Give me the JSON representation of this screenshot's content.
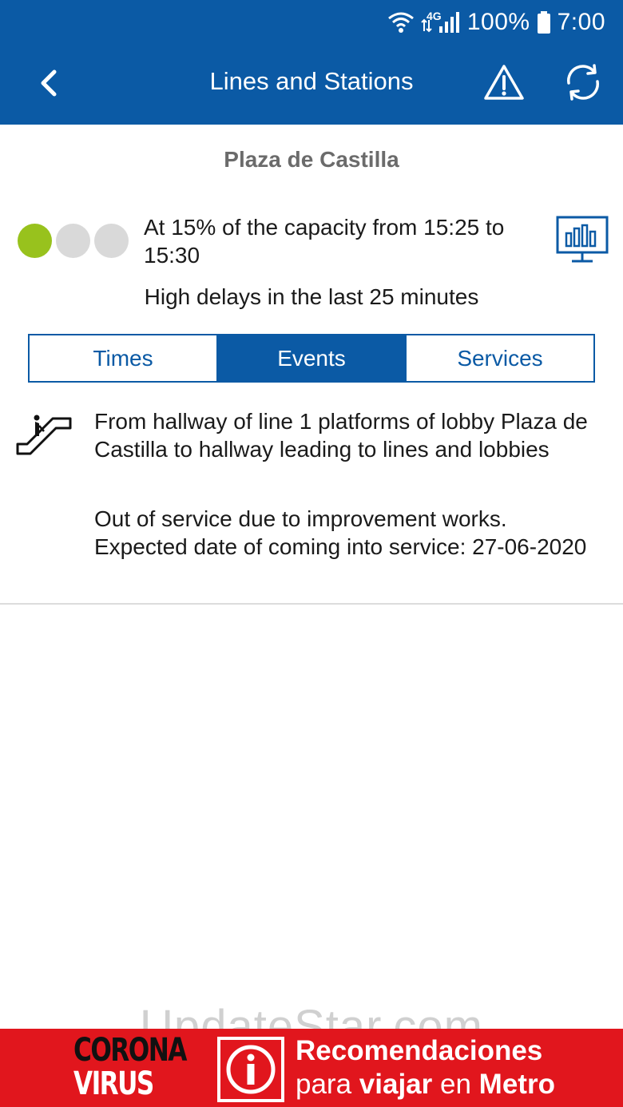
{
  "status_bar": {
    "network": "4G",
    "battery": "100%",
    "time": "7:00"
  },
  "toolbar": {
    "title": "Lines and Stations",
    "back_icon": "chevron-left-icon",
    "alert_icon": "warning-triangle-icon",
    "refresh_icon": "refresh-icon"
  },
  "station": {
    "name": "Plaza de Castilla",
    "capacity": {
      "level": 1,
      "max_level": 3,
      "text": "At 15% of the capacity from 15:25 to 15:30"
    },
    "stats_icon": "bar-chart-monitor-icon",
    "delay_text": "High delays in the last 25 minutes"
  },
  "tabs": [
    {
      "label": "Times",
      "active": false
    },
    {
      "label": "Events",
      "active": true
    },
    {
      "label": "Services",
      "active": false
    }
  ],
  "events": [
    {
      "icon": "escalator-icon",
      "location": "From hallway of line 1 platforms of lobby Plaza de Castilla to hallway leading to lines and lobbies",
      "description": "Out of service due to improvement works. Expected date of coming into service: 27-06-2020"
    }
  ],
  "banner": {
    "corona_line1": "CORONA",
    "corona_line2": "VIRUS",
    "info_icon": "info-icon",
    "line1": "Recomendaciones",
    "line2_prefix": "para",
    "line2_bold1": "viajar",
    "line2_mid": "en",
    "line2_bold2": "Metro"
  },
  "watermark": "UpdateStar.com",
  "colors": {
    "primary": "#0b5aa5",
    "capacity_on": "#98c21d",
    "capacity_off": "#d9d9d9",
    "banner_red": "#e1161d"
  }
}
